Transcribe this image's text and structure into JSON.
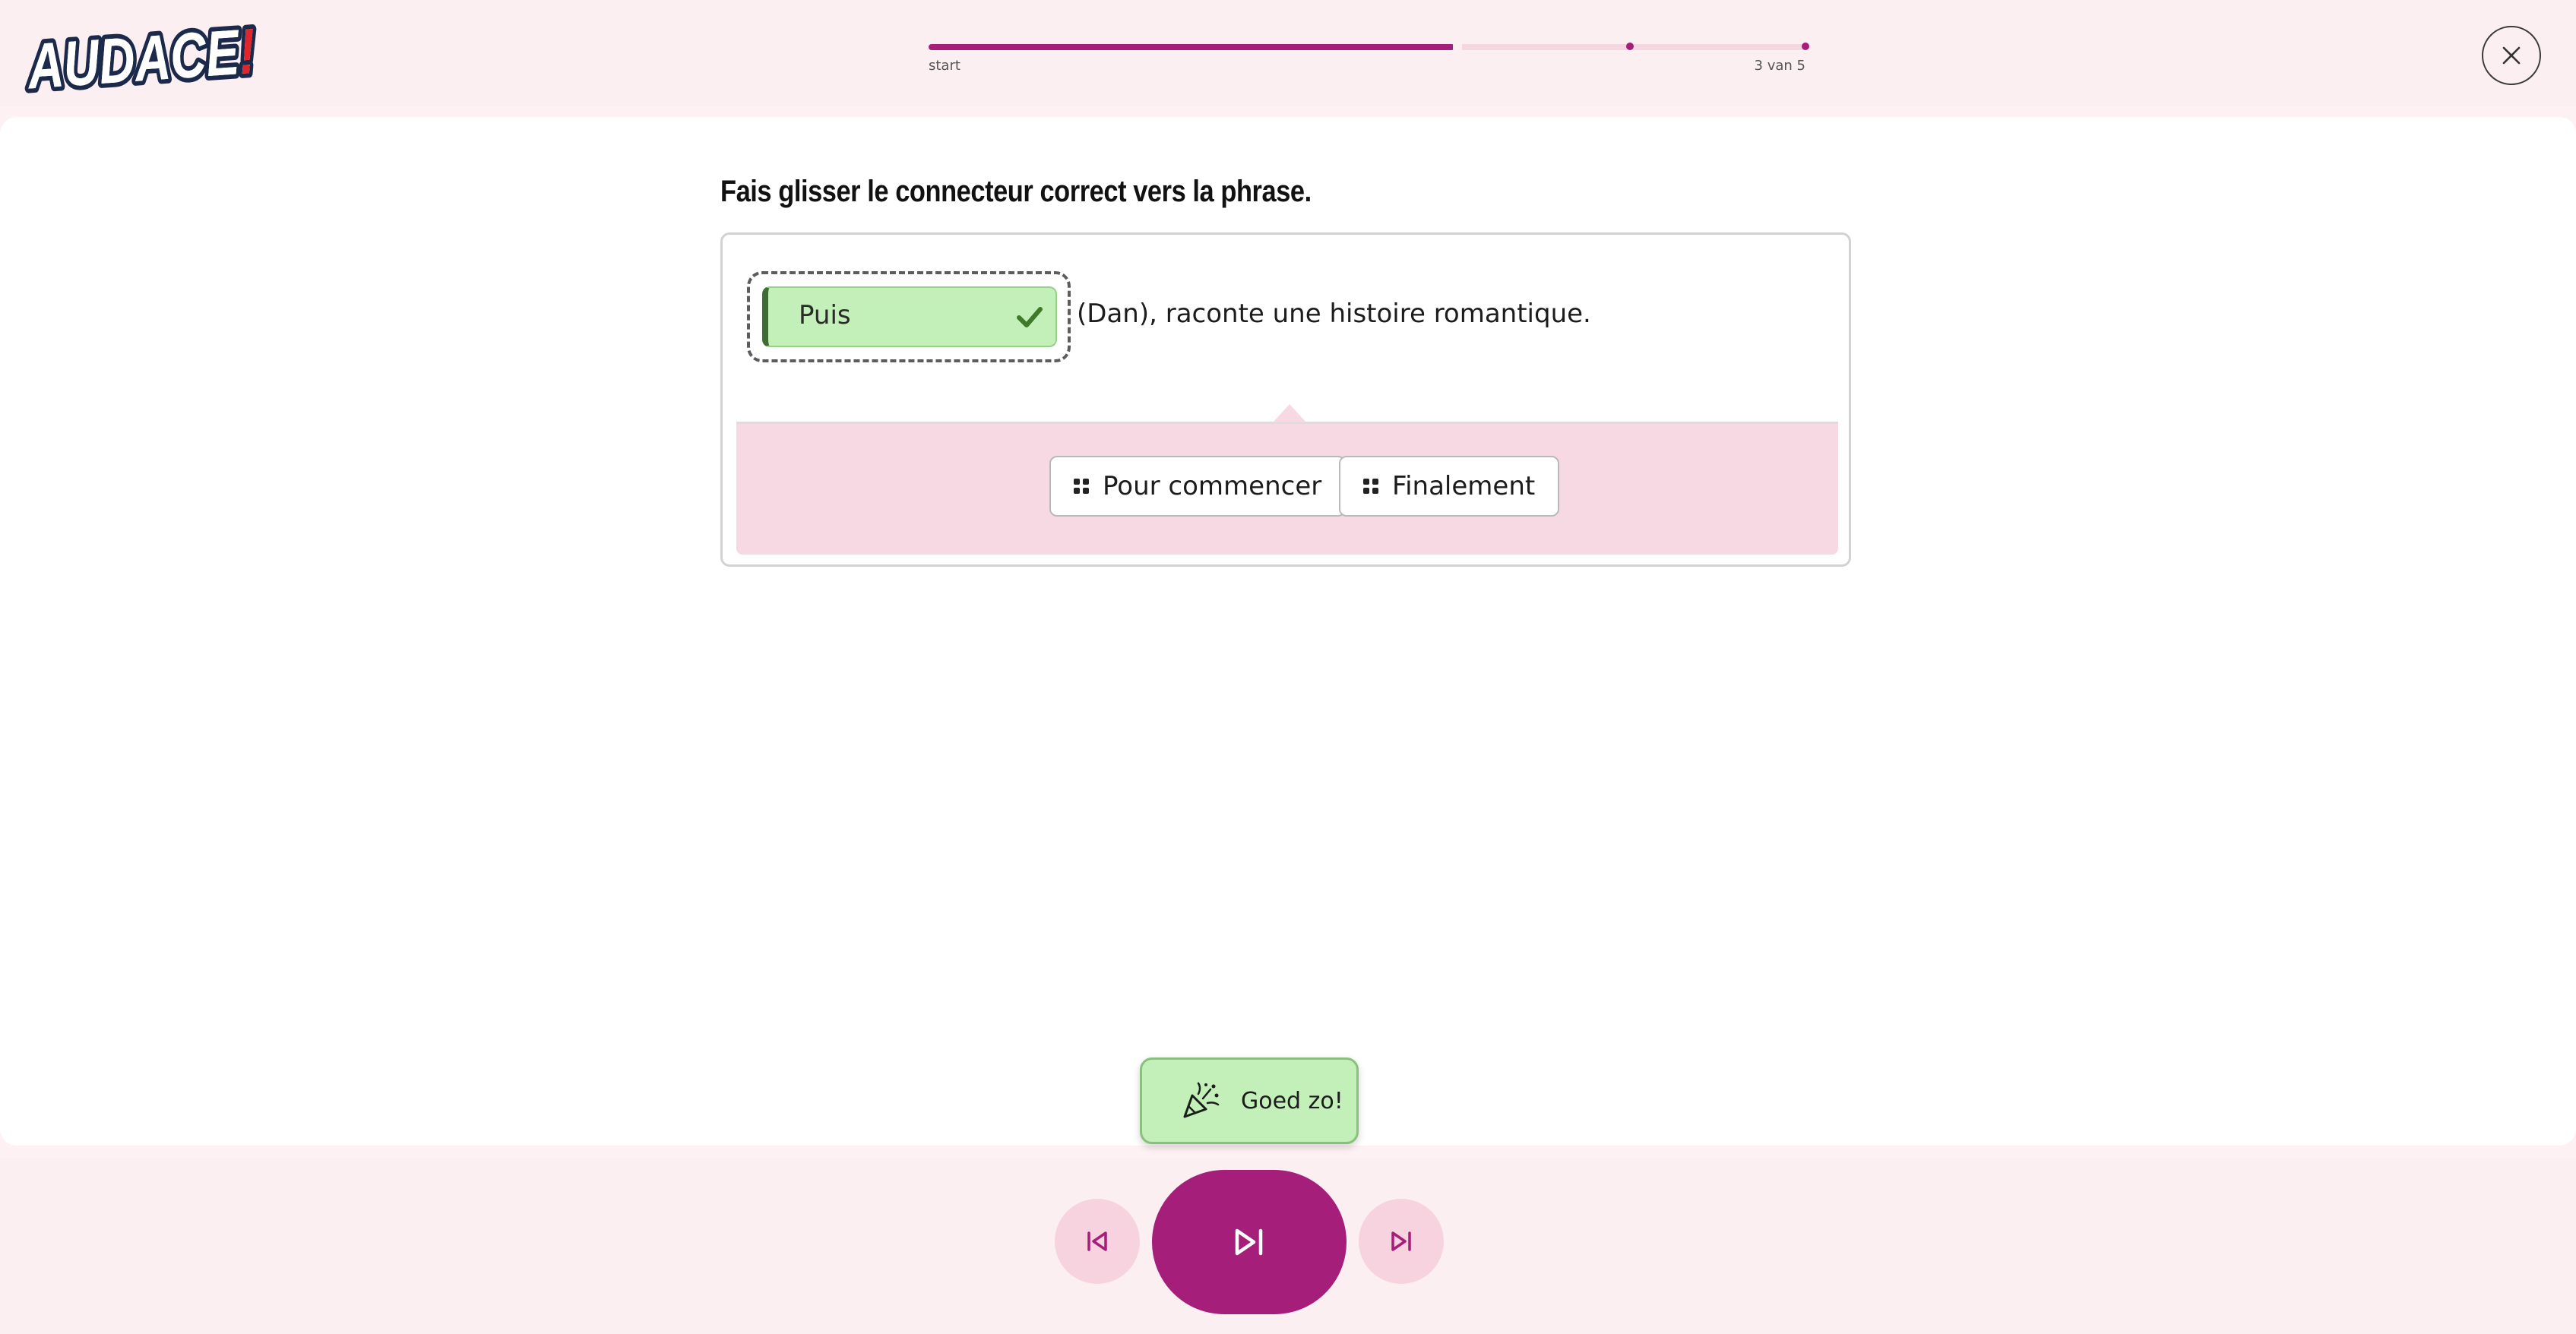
{
  "header": {
    "logo_text": "AUDACE!",
    "progress": {
      "start_label": "start",
      "end_label": "3 van 5",
      "filled_fraction": 0.6,
      "step_dots": [
        0.8,
        1.0
      ]
    },
    "close_icon": "close-icon"
  },
  "exercise": {
    "instruction": "Fais glisser le connecteur correct vers la phrase.",
    "placed_answer": "Puis",
    "placed_answer_status": "correct",
    "sentence_rest": "(Dan), raconte une histoire romantique.",
    "options": [
      {
        "label": "Pour commencer"
      },
      {
        "label": "Finalement"
      }
    ]
  },
  "feedback": {
    "message": "Goed zo!",
    "icon": "party-popper-icon"
  },
  "footer": {
    "prev_icon": "skip-back-icon",
    "next_icon": "skip-forward-icon",
    "skip_icon": "skip-forward-icon"
  },
  "colors": {
    "accent": "#a51e79",
    "accent_light": "#f7d3e0",
    "correct_bg": "#c3f0b9",
    "page_bg": "#fbeff2"
  }
}
